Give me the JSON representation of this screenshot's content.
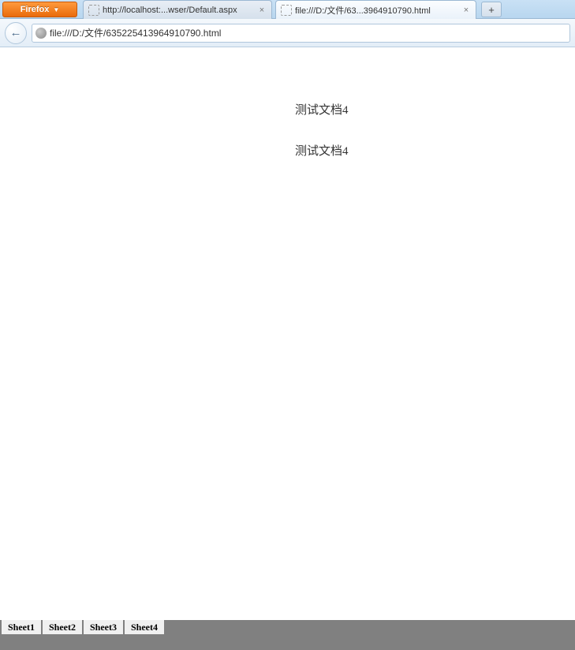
{
  "firefox_button": "Firefox",
  "tabs": [
    {
      "label": "http://localhost:...wser/Default.aspx"
    },
    {
      "label": "file:///D:/文件/63...3964910790.html"
    }
  ],
  "url": "file:///D:/文件/635225413964910790.html",
  "document": {
    "title": "测试文档4",
    "body": "测试文档4"
  },
  "sheets": [
    "Sheet1",
    "Sheet2",
    "Sheet3",
    "Sheet4"
  ]
}
